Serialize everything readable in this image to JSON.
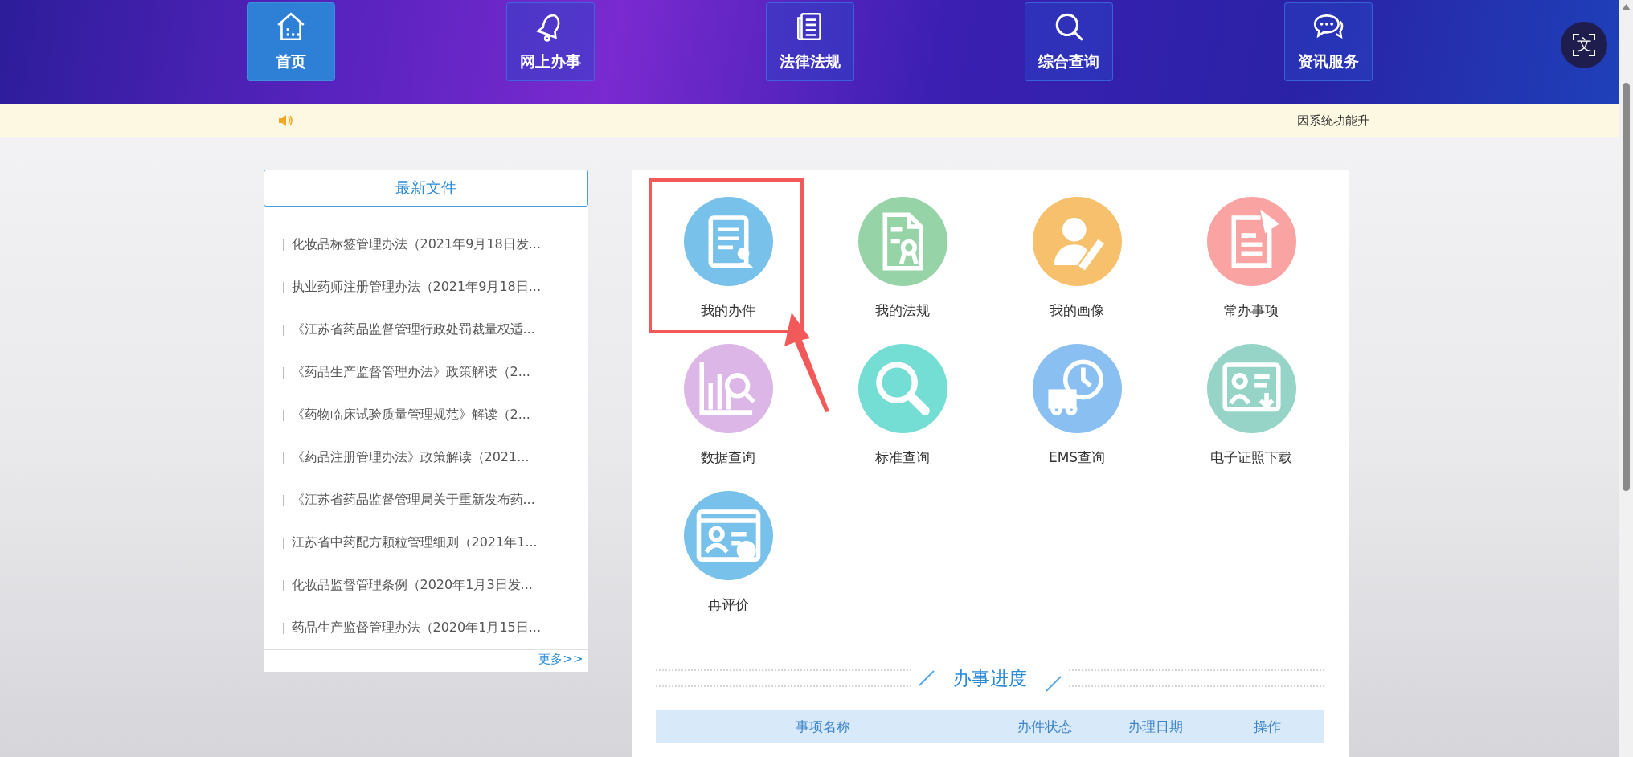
{
  "nav": [
    {
      "label": "首页",
      "kind": "home",
      "selected": true
    },
    {
      "label": "网上办事",
      "kind": "bell",
      "selected": false
    },
    {
      "label": "法律法规",
      "kind": "newspaper",
      "selected": false
    },
    {
      "label": "综合查询",
      "kind": "search",
      "selected": false
    },
    {
      "label": "资讯服务",
      "kind": "chat",
      "selected": false
    }
  ],
  "translate_button": {
    "glyph": "文"
  },
  "notice": {
    "text": "因系统功能升"
  },
  "latest_files": {
    "title": "最新文件",
    "items": [
      "化妆品标签管理办法（2021年9月18日发...",
      "执业药师注册管理办法（2021年9月18日...",
      "《江苏省药品监督管理行政处罚裁量权适...",
      "《药品生产监督管理办法》政策解读（2...",
      "《药物临床试验质量管理规范》解读（2...",
      "《药品注册管理办法》政策解读（2021...",
      "《江苏省药品监督管理局关于重新发布药...",
      "江苏省中药配方颗粒管理细则（2021年1...",
      "化妆品监督管理条例（2020年1月3日发...",
      "药品生产监督管理办法（2020年1月15日..."
    ],
    "more": "更多>>"
  },
  "services": [
    {
      "label": "我的办件",
      "kind": "document",
      "color": "#78c1ea"
    },
    {
      "label": "我的法规",
      "kind": "certificate",
      "color": "#96d4a8"
    },
    {
      "label": "我的画像",
      "kind": "portrait",
      "color": "#f6c06c"
    },
    {
      "label": "常办事项",
      "kind": "memo",
      "color": "#f9a3a3"
    },
    {
      "label": "数据查询",
      "kind": "chart",
      "color": "#dcb6e6"
    },
    {
      "label": "标准查询",
      "kind": "magnifier",
      "color": "#74ddd4"
    },
    {
      "label": "EMS查询",
      "kind": "delivery",
      "color": "#8abff2"
    },
    {
      "label": "电子证照下载",
      "kind": "license",
      "color": "#96d4c8"
    },
    {
      "label": "再评价",
      "kind": "profile",
      "color": "#78c1ea"
    }
  ],
  "progress": {
    "title": "办事进度",
    "columns": [
      "事项名称",
      "办件状态",
      "办理日期",
      "操作"
    ]
  }
}
